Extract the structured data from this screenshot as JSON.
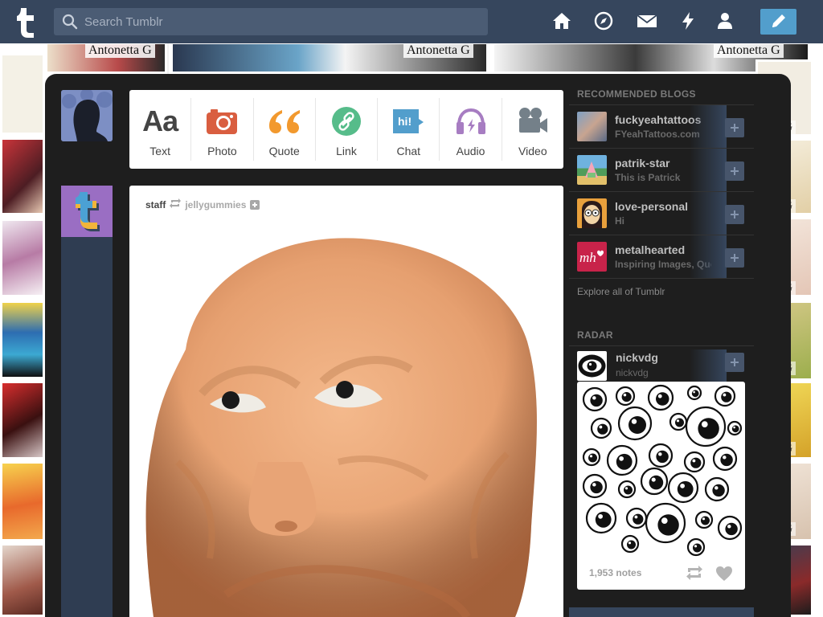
{
  "header": {
    "search_placeholder": "Search Tumblr",
    "icons": [
      "tumblr-logo",
      "home-icon",
      "explore-compass-icon",
      "inbox-envelope-icon",
      "activity-bolt-icon",
      "account-person-icon",
      "compose-pencil-icon"
    ]
  },
  "background": {
    "watermark": "Antonetta G",
    "watermark_short": "ta G"
  },
  "post_types": [
    {
      "label": "Text",
      "icon": "text-aa-icon",
      "color": "#444444"
    },
    {
      "label": "Photo",
      "icon": "camera-icon",
      "color": "#d95e40"
    },
    {
      "label": "Quote",
      "icon": "quote-icon",
      "color": "#f2992e"
    },
    {
      "label": "Link",
      "icon": "link-icon",
      "color": "#56bc8a"
    },
    {
      "label": "Chat",
      "icon": "chat-bubble-icon",
      "color": "#529ecc"
    },
    {
      "label": "Audio",
      "icon": "headphones-icon",
      "color": "#a77dc2"
    },
    {
      "label": "Video",
      "icon": "video-camera-icon",
      "color": "#748089"
    }
  ],
  "post": {
    "author": "staff",
    "reblogged_from": "jellygummies"
  },
  "sidebar": {
    "recommended_heading": "RECOMMENDED BLOGS",
    "blogs": [
      {
        "name": "fuckyeahtattoos",
        "title": "FYeahTattoos.com"
      },
      {
        "name": "patrik-star",
        "title": "This is Patrick"
      },
      {
        "name": "love-personal",
        "title": "Hi"
      },
      {
        "name": "metalhearted",
        "title": "Inspiring Images, Quotes"
      }
    ],
    "explore_label": "Explore all of Tumblr",
    "radar_heading": "RADAR",
    "radar": {
      "name": "nickvdg",
      "title": "nickvdg",
      "notes": "1,953 notes"
    }
  },
  "colors": {
    "header": "#36465d",
    "panel": "#1e1e1e",
    "compose": "#529ecc"
  }
}
